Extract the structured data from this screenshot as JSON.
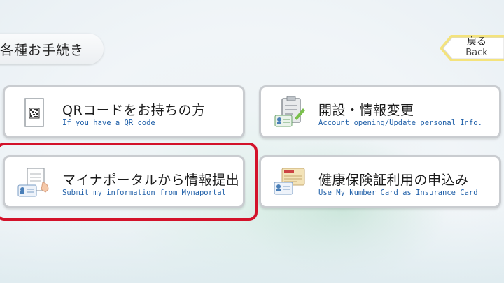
{
  "header": {
    "title": "各種お手続き"
  },
  "back_button": {
    "label_jp": "戻る",
    "label_en": "Back"
  },
  "cards": [
    {
      "title": "QRコードをお持ちの方",
      "subtitle": "If you have a QR code",
      "icon": "qr-code-icon"
    },
    {
      "title": "開設・情報変更",
      "subtitle": "Account opening/Update personal Info.",
      "icon": "clipboard-id-icon"
    },
    {
      "title": "マイナポータルから情報提出",
      "subtitle": "Submit my information from Mynaportal",
      "icon": "document-card-icon"
    },
    {
      "title": "健康保険証利用の申込み",
      "subtitle": "Use My Number Card as Insurance Card",
      "icon": "insurance-card-icon"
    }
  ],
  "colors": {
    "highlight": "#d3122a",
    "subtitle": "#1f5fa8",
    "back_border": "#f0e07a"
  }
}
